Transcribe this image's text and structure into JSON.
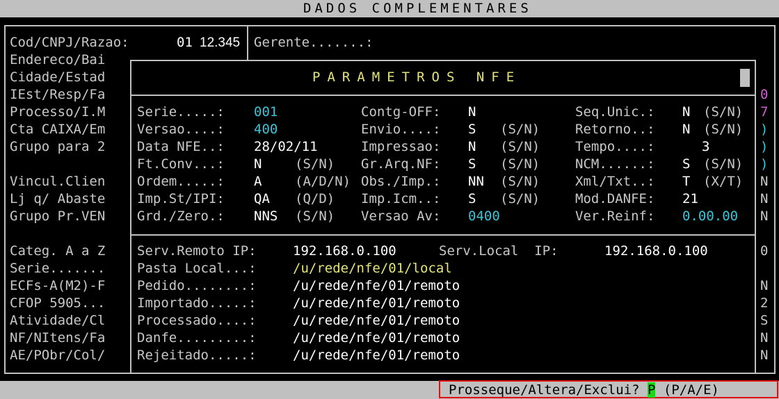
{
  "window": {
    "title": "DADOS COMPLEMENTARES"
  },
  "main": {
    "cod_label": "Cod/CNPJ/Razao:",
    "cod_value": "01",
    "cnpj_value": "12.345",
    "gerente_label": "Gerente.......:",
    "left_labels": [
      "Endereco/Bai",
      "Cidade/Estad",
      "IEst/Resp/Fa",
      "Processo/I.M",
      "Cta CAIXA/Em",
      "Grupo para 2",
      "",
      "Vincul.Clien",
      "Lj q/ Abaste",
      "Grupo Pr.VEN",
      "",
      "Categ. A a Z",
      "Serie.......",
      "ECFs-A(M2)-F",
      "CFOP 5905...",
      "Atividade/Cl",
      "NF/NItens/Fa",
      "AE/PObr/Col/"
    ],
    "right_edge": [
      "0",
      "7",
      ")",
      ")",
      ")",
      "N",
      "N",
      "N",
      "",
      "0",
      "",
      "N",
      "2",
      "S",
      "N",
      "N"
    ]
  },
  "popup": {
    "title": "PARAMETROS NFE",
    "rows": [
      {
        "c1l": "Serie.....:",
        "c1v": "001",
        "c1s": "",
        "c2l": "Contg-OFF:",
        "c2v": "N",
        "c2s": "",
        "c3l": "Seq.Unic.:",
        "c3v": "N",
        "c3s": "(S/N)"
      },
      {
        "c1l": "Versao....:",
        "c1v": "400",
        "c1s": "",
        "c2l": "Envio....:",
        "c2v": "S",
        "c2s": "(S/N)",
        "c3l": "Retorno..:",
        "c3v": "N",
        "c3s": "(S/N)"
      },
      {
        "c1l": "Data NFE..:",
        "c1v": "28/02/11",
        "c1s": "",
        "c2l": "Impressao:",
        "c2v": "N",
        "c2s": "(S/N)",
        "c3l": "Tempo....:",
        "c3v": "3",
        "c3s": ""
      },
      {
        "c1l": "Ft.Conv...:",
        "c1v": "N",
        "c1s": "(S/N)",
        "c2l": "Gr.Arq.NF:",
        "c2v": "S",
        "c2s": "(S/N)",
        "c3l": "NCM......:",
        "c3v": "S",
        "c3s": "(S/N)"
      },
      {
        "c1l": "Ordem.....:",
        "c1v": "A",
        "c1s": "(A/D/N)",
        "c2l": "Obs./Imp.:",
        "c2v": "NN",
        "c2s": "(S/N)",
        "c3l": "Xml/Txt..:",
        "c3v": "T",
        "c3s": "(X/T)"
      },
      {
        "c1l": "Imp.St/IPI:",
        "c1v": "QA",
        "c1s": "(Q/D)",
        "c2l": "Imp.Icm..:",
        "c2v": "S",
        "c2s": "(S/N)",
        "c3l": "Mod.DANFE:",
        "c3v": "21",
        "c3s": ""
      },
      {
        "c1l": "Grd./Zero.:",
        "c1v": "NNS",
        "c1s": "(S/N)",
        "c2l": "Versao Av:",
        "c2v": "0400",
        "c2s": "",
        "c3l": "Ver.Reinf:",
        "c3v": "0.00.00",
        "c3s": ""
      }
    ],
    "serv_remoto_label": "Serv.Remoto IP:",
    "serv_remoto_ip": "192.168.0.100",
    "serv_local_label": "Serv.Local  IP:",
    "serv_local_ip": "192.168.0.100",
    "paths": [
      {
        "label": "Pasta Local...:",
        "value": "/u/rede/nfe/01/local"
      },
      {
        "label": "Pedido........:",
        "value": "/u/rede/nfe/01/remoto"
      },
      {
        "label": "Importado.....:",
        "value": "/u/rede/nfe/01/remoto"
      },
      {
        "label": "Processado....:",
        "value": "/u/rede/nfe/01/remoto"
      },
      {
        "label": "Danfe.........:",
        "value": "/u/rede/nfe/01/remoto"
      },
      {
        "label": "Rejeitado.....:",
        "value": "/u/rede/nfe/01/remoto"
      }
    ]
  },
  "status": {
    "prompt": "Prosseque/Altera/Exclui?",
    "answer": "P",
    "options": "(P/A/E)"
  },
  "colors": {
    "cyan": "#39c5d8",
    "yellow": "#e4e47a",
    "prompt_border": "#e01010",
    "answer_bg": "#18d818"
  }
}
